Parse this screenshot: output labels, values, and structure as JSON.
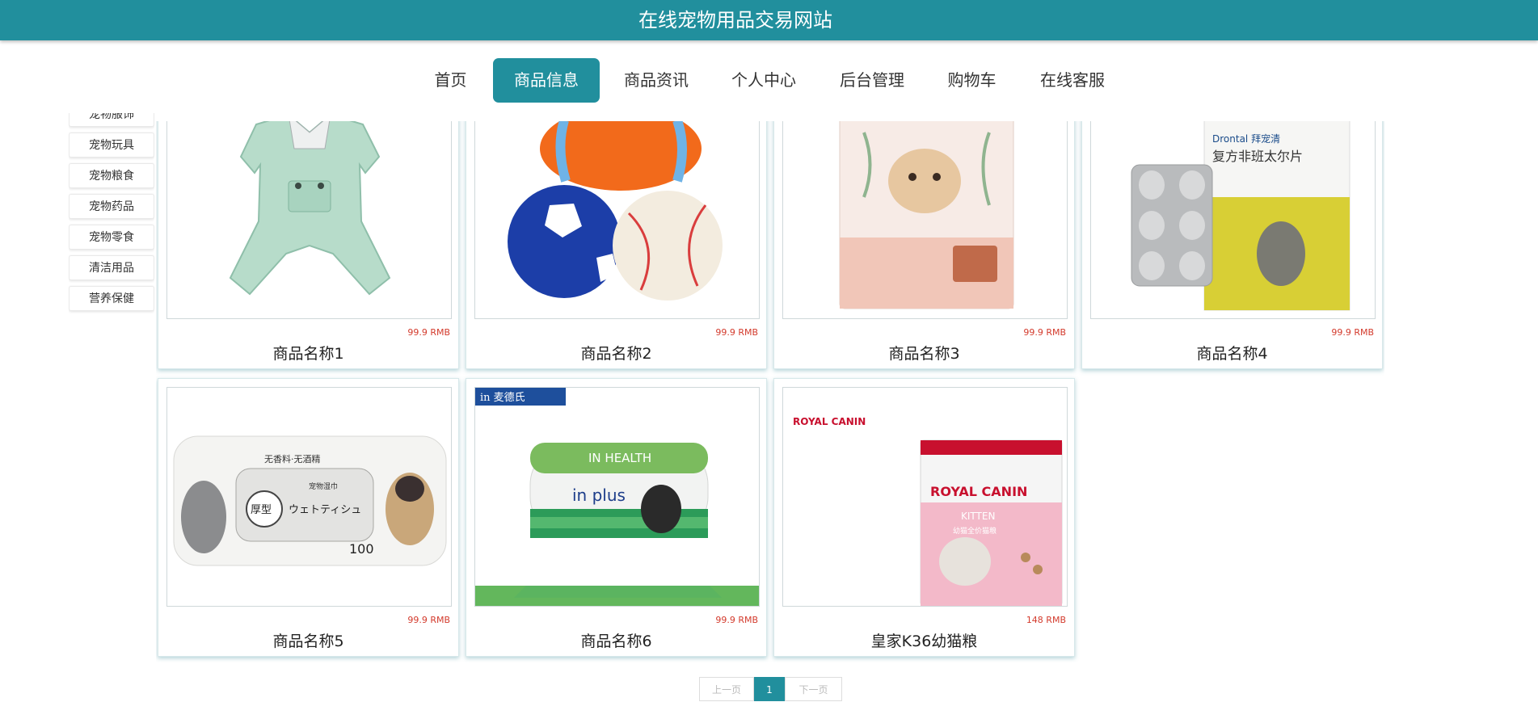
{
  "header": {
    "title": "在线宠物用品交易网站"
  },
  "nav": [
    {
      "label": "首页"
    },
    {
      "label": "商品信息",
      "active": true
    },
    {
      "label": "商品资讯"
    },
    {
      "label": "个人中心"
    },
    {
      "label": "后台管理"
    },
    {
      "label": "购物车"
    },
    {
      "label": "在线客服"
    }
  ],
  "sidebar": [
    {
      "label": "宠物服饰"
    },
    {
      "label": "宠物玩具"
    },
    {
      "label": "宠物粮食"
    },
    {
      "label": "宠物药品"
    },
    {
      "label": "宠物零食"
    },
    {
      "label": "清洁用品"
    },
    {
      "label": "营养保健"
    }
  ],
  "products": [
    {
      "name": "商品名称1",
      "price": "99.9 RMB",
      "image": "pet-clothes-image"
    },
    {
      "name": "商品名称2",
      "price": "99.9 RMB",
      "image": "pet-toy-balls-image"
    },
    {
      "name": "商品名称3",
      "price": "99.9 RMB",
      "image": "pet-food-bag-image"
    },
    {
      "name": "商品名称4",
      "price": "99.9 RMB",
      "image": "pet-medicine-image",
      "label_lines": [
        "Drontal 拜宠清",
        "复方非班太尔片"
      ]
    },
    {
      "name": "商品名称5",
      "price": "99.9 RMB",
      "image": "pet-wipes-image",
      "label_lines": [
        "无香料·无酒精",
        "宠物湿巾",
        "厚型",
        "ウェトティシュ",
        "100"
      ]
    },
    {
      "name": "商品名称6",
      "price": "99.9 RMB",
      "image": "pet-supplement-image",
      "label_lines": [
        "in 麦德氏",
        "IN HEALTH",
        "in plus"
      ]
    },
    {
      "name": "皇家K36幼猫粮",
      "price": "148 RMB",
      "image": "cat-food-image",
      "label_lines": [
        "ROYAL CANIN",
        "ROYAL CANIN",
        "KITTEN",
        "幼猫全价猫粮"
      ]
    }
  ],
  "pagination": {
    "prev": "上一页",
    "current": "1",
    "next": "下一页"
  },
  "colors": {
    "accent": "#218f9d",
    "price": "#d33a2c"
  }
}
